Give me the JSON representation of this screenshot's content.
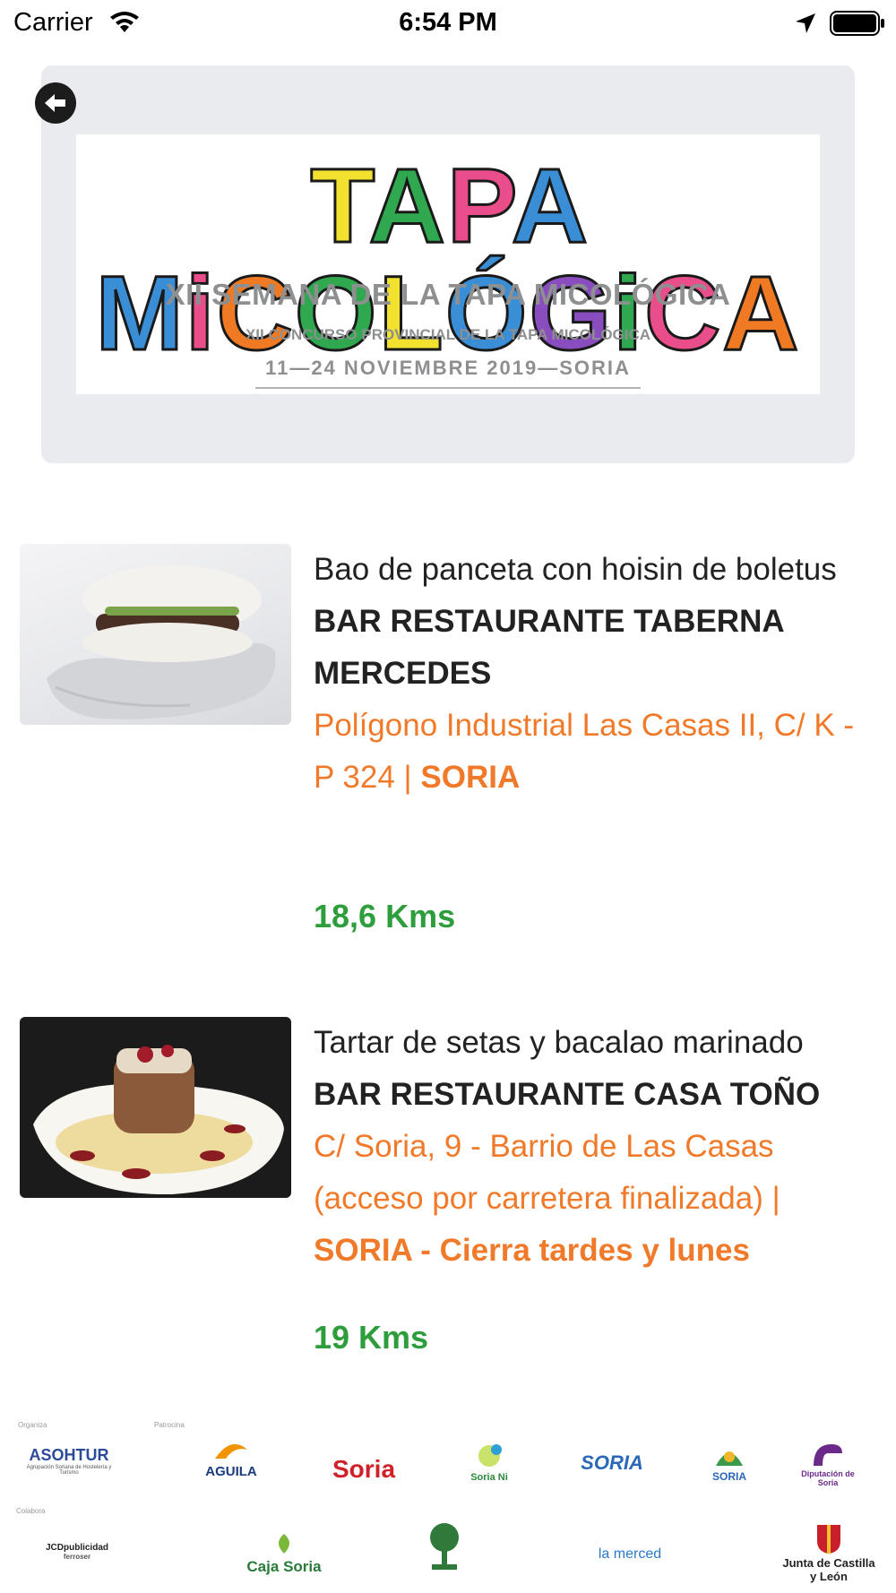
{
  "status_bar": {
    "carrier": "Carrier",
    "time": "6:54 PM"
  },
  "banner": {
    "title_letters": [
      "T",
      "A",
      "P",
      "A",
      " ",
      "M",
      "i",
      "C",
      "O",
      "L",
      "Ó",
      "G",
      "i",
      "C",
      "A"
    ],
    "subtitle": "XII SEMANA DE LA TAPA MICOLÓGICA",
    "subtitle2": "XII CONCURSO PROVINCIAL DE LA TAPA MICOLÓGICA",
    "dates": "11—24 NOVIEMBRE 2019—SORIA"
  },
  "items": [
    {
      "dish": "Bao de panceta con hoisin de boletus",
      "place": "BAR RESTAURANTE TABERNA MERCEDES",
      "address": "Polígono Industrial Las Casas II, C/ K - P 324 | ",
      "city": "SORIA",
      "distance": "18,6 Kms"
    },
    {
      "dish": "Tartar de setas y bacalao marinado",
      "place": "BAR RESTAURANTE CASA TOÑO",
      "address": "C/ Soria, 9 - Barrio de Las Casas (acceso por carretera finalizada) | ",
      "city": "SORIA - Cierra tardes y lunes",
      "distance": "19 Kms"
    }
  ],
  "sponsors": {
    "caption_organiza": "Organiza",
    "caption_patrocina": "Patrocina",
    "caption_colabora": "Colabora",
    "logos_row1": [
      "ASOHTUR",
      "AGUILA",
      "Soria",
      "Soria Ni",
      "SORIA",
      "SORIA",
      "Diputación de Soria"
    ],
    "asohtur_sub": "Agrupación Soriana de Hostelería y Turismo",
    "logos_row2": [
      "JCDpublicidad",
      "Caja Soria",
      "la merced",
      "Junta de Castilla y León"
    ],
    "jcd_sub": "ferroser",
    "caja_rural": "Caja",
    "caja_soria": "Soria"
  },
  "colors": {
    "address": "#f07a2a",
    "distance": "#2e9d3c",
    "banner_bg": "#e9ebee"
  }
}
